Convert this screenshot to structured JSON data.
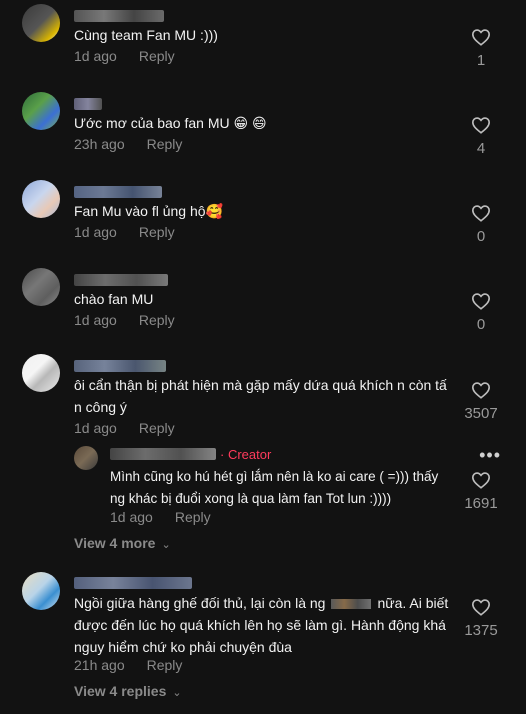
{
  "comments": [
    {
      "text": "Cùng team Fan MU :)))",
      "time": "1d ago",
      "reply": "Reply",
      "likes": "1"
    },
    {
      "text": "Ước mơ của bao fan MU 😁 😄",
      "time": "23h ago",
      "reply": "Reply",
      "likes": "4"
    },
    {
      "text": "Fan Mu vào fl ủng hộ🥰",
      "time": "1d ago",
      "reply": "Reply",
      "likes": "0"
    },
    {
      "text": "chào fan MU",
      "time": "1d ago",
      "reply": "Reply",
      "likes": "0"
    },
    {
      "text_line1": "ôi cẩn thận bị phát hiện mà gặp mấy dứa quá khích n còn tấ",
      "text_line2": "n công ý",
      "time": "1d ago",
      "reply": "Reply",
      "likes": "3507"
    },
    {
      "text_line1": "Ngồi giữa hàng ghế đối thủ, lại còn là ng",
      "text_line1b": "nữa. Ai biết",
      "text_line2": "được đến lúc họ quá khích lên họ sẽ làm gì. Hành động khá",
      "text_line3": "nguy hiểm chứ ko phải chuyện đùa",
      "time": "21h ago",
      "reply": "Reply",
      "likes": "1375"
    }
  ],
  "creator_reply": {
    "badge": "· Creator",
    "text_line1": "Mình cũng ko hú hét gì lắm nên là ko ai care ( =))) thấy",
    "text_line2": "ng khác bị đuổi xong là qua làm fan Tot lun :))))",
    "time": "1d ago",
    "reply": "Reply",
    "likes": "1691",
    "menu": "•••"
  },
  "view_more_1": "View 4 more",
  "view_more_2": "View 4 replies",
  "icons": {
    "like": "heart-icon",
    "expand": "chevron-down-icon",
    "menu": "more-options-icon"
  }
}
